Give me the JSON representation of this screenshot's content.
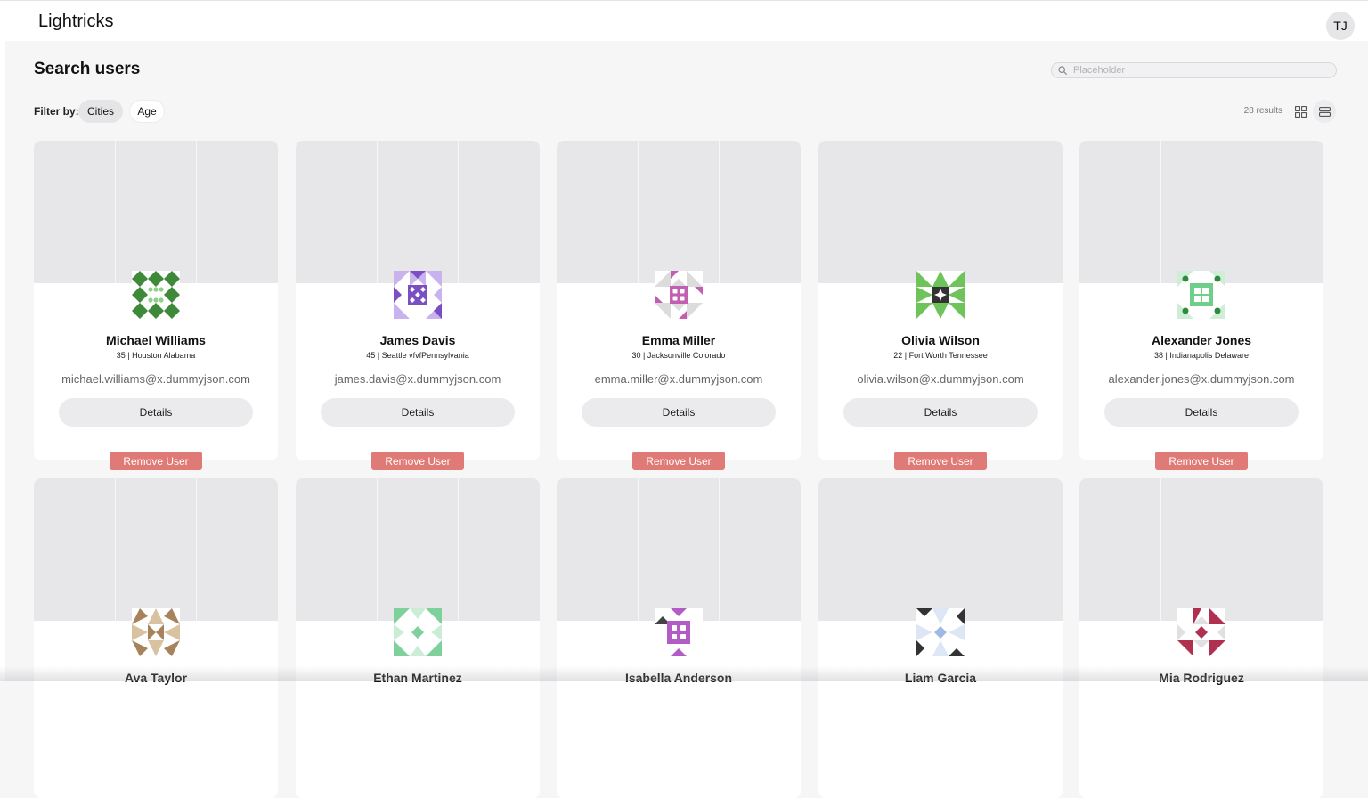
{
  "app": {
    "title": "Lightricks",
    "avatar_initials": "TJ"
  },
  "page": {
    "title": "Search users"
  },
  "search": {
    "placeholder": "Placeholder",
    "icon": "search-icon"
  },
  "filters": {
    "label": "Filter by:",
    "chips": [
      "Cities",
      "Age"
    ],
    "active": "Cities"
  },
  "results": {
    "text": "28 results"
  },
  "view_toggle": {
    "grid_icon": "grid-view-icon",
    "list_icon": "list-view-icon",
    "active": "list"
  },
  "colors": {
    "remove_button": "#e07a76",
    "cover": "#e7e7e9",
    "page_bg": "#f6f6f7"
  },
  "users": [
    {
      "name": "Michael Williams",
      "meta": "35 | Houston Alabama",
      "email": "michael.williams@x.dummyjson.com",
      "details_label": "Details",
      "remove_label": "Remove User",
      "avatar_color": "#3e8a3a",
      "avatar_accent": "#8fd08a"
    },
    {
      "name": "James Davis",
      "meta": "45 | Seattle vfvfPennsylvania",
      "email": "james.davis@x.dummyjson.com",
      "details_label": "Details",
      "remove_label": "Remove User",
      "avatar_color": "#7a4fc4",
      "avatar_accent": "#c9b3ee"
    },
    {
      "name": "Emma Miller",
      "meta": "30 | Jacksonville Colorado",
      "email": "emma.miller@x.dummyjson.com",
      "details_label": "Details",
      "remove_label": "Remove User",
      "avatar_color": "#c25fb0",
      "avatar_accent": "#dcdcdc"
    },
    {
      "name": "Olivia Wilson",
      "meta": "22 | Fort Worth Tennessee",
      "email": "olivia.wilson@x.dummyjson.com",
      "details_label": "Details",
      "remove_label": "Remove User",
      "avatar_color": "#333333",
      "avatar_accent": "#6ec35a"
    },
    {
      "name": "Alexander Jones",
      "meta": "38 | Indianapolis Delaware",
      "email": "alexander.jones@x.dummyjson.com",
      "details_label": "Details",
      "remove_label": "Remove User",
      "avatar_color": "#6fcf8a",
      "avatar_accent": "#2e8a3e"
    },
    {
      "name": "Ava Taylor",
      "avatar_color": "#a8825a",
      "avatar_accent": "#d9c2a0"
    },
    {
      "name": "Ethan Martinez",
      "avatar_color": "#7fd19b",
      "avatar_accent": "#c9eed5"
    },
    {
      "name": "Isabella Anderson",
      "avatar_color": "#b45cc6",
      "avatar_accent": "#444444"
    },
    {
      "name": "Liam Garcia",
      "avatar_color": "#333333",
      "avatar_accent": "#9fb9e6"
    },
    {
      "name": "Mia Rodriguez",
      "avatar_color": "#b0304f",
      "avatar_accent": "#e0e0e0"
    }
  ]
}
